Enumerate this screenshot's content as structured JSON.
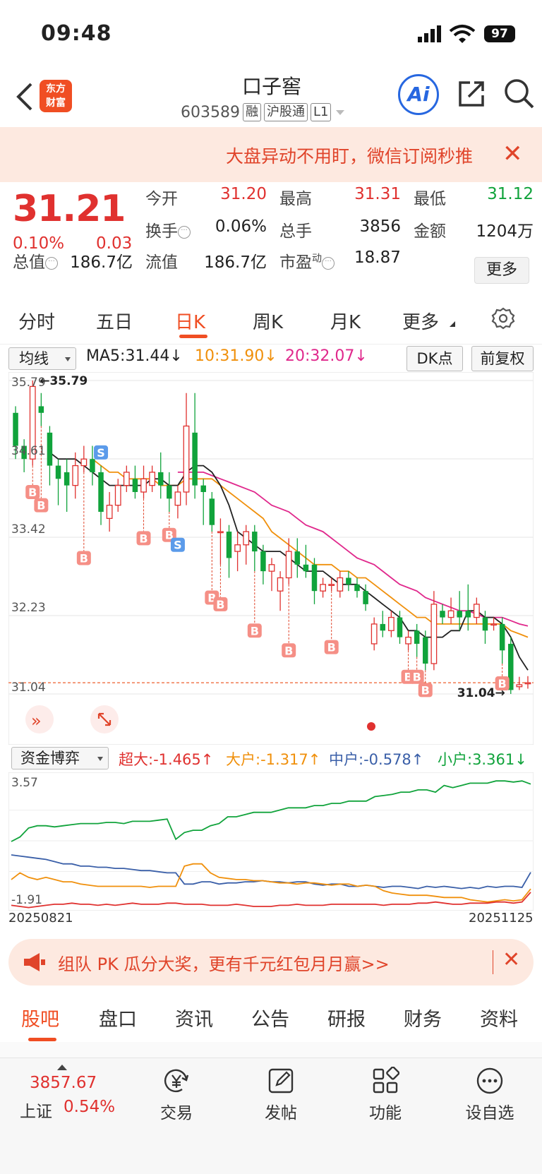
{
  "status_bar": {
    "time": "09:48",
    "battery": "97"
  },
  "header": {
    "logo_line1": "东方",
    "logo_line2": "财富",
    "stock_name": "口子窖",
    "stock_code": "603589",
    "tags": [
      "融",
      "沪股通",
      "L1"
    ],
    "ai_label": "Ai"
  },
  "notice": {
    "text": "大盘异动不用盯，微信订阅秒推",
    "close": "✕"
  },
  "quote": {
    "price": "31.21",
    "change_pct": "0.10%",
    "change": "0.03",
    "open_label": "今开",
    "open": "31.20",
    "high_label": "最高",
    "high": "31.31",
    "low_label": "最低",
    "low": "31.12",
    "turnover_label": "换手",
    "turnover": "0.06%",
    "volume_label": "总手",
    "volume": "3856",
    "amount_label": "金额",
    "amount": "1204万",
    "mktcap_label": "总值",
    "mktcap": "186.7亿",
    "float_label": "流值",
    "float_cap": "186.7亿",
    "pe_label": "市盈",
    "pe_sup": "动",
    "pe": "18.87",
    "more": "更多"
  },
  "period_tabs": [
    "分时",
    "五日",
    "日K",
    "周K",
    "月K",
    "更多"
  ],
  "ma_bar": {
    "selector": "均线",
    "ma5": "MA5:31.44↓",
    "ma10": "10:31.90↓",
    "ma20": "20:32.07↓",
    "dk": "DK点",
    "fuquan": "前复权"
  },
  "colors": {
    "up": "#e0312f",
    "down": "#10a33b",
    "ma5": "#222222",
    "ma10": "#f0900c",
    "ma20": "#e0288c",
    "accent": "#f04e23"
  },
  "chart_data": {
    "type": "candlestick",
    "y_ticks": [
      "35.79",
      "34.61",
      "33.42",
      "32.23",
      "31.04"
    ],
    "ylim": [
      31.04,
      35.79
    ],
    "max_label": "35.79",
    "min_label": "31.04",
    "last_close": 31.21,
    "candles": [
      [
        35.3,
        34.8,
        35.4,
        34.6
      ],
      [
        34.8,
        34.6,
        34.9,
        34.4
      ],
      [
        34.6,
        35.7,
        35.79,
        34.5
      ],
      [
        35.4,
        35.3,
        35.6,
        35.1
      ],
      [
        35.0,
        34.5,
        35.1,
        34.2
      ],
      [
        34.5,
        34.3,
        34.6,
        33.9
      ],
      [
        34.4,
        34.2,
        34.6,
        33.8
      ],
      [
        34.2,
        34.5,
        34.7,
        34.0
      ],
      [
        34.5,
        34.6,
        34.8,
        34.4
      ],
      [
        34.6,
        34.4,
        34.8,
        34.2
      ],
      [
        34.4,
        33.8,
        34.5,
        33.6
      ],
      [
        33.7,
        33.9,
        34.1,
        33.5
      ],
      [
        33.9,
        34.2,
        34.3,
        33.8
      ],
      [
        34.2,
        34.4,
        34.5,
        34.1
      ],
      [
        34.3,
        34.1,
        34.5,
        34.0
      ],
      [
        34.1,
        34.3,
        34.5,
        34.0
      ],
      [
        34.2,
        34.4,
        34.5,
        34.1
      ],
      [
        34.4,
        34.2,
        34.7,
        34.0
      ],
      [
        34.2,
        34.0,
        34.4,
        33.8
      ],
      [
        33.9,
        34.1,
        34.2,
        33.7
      ],
      [
        34.1,
        35.1,
        35.6,
        33.9
      ],
      [
        35.0,
        34.2,
        35.6,
        34.0
      ],
      [
        34.2,
        34.1,
        34.3,
        33.6
      ],
      [
        34.0,
        33.6,
        34.1,
        33.5
      ],
      [
        33.5,
        33.5,
        33.7,
        33.0
      ],
      [
        33.5,
        33.1,
        33.6,
        32.8
      ],
      [
        33.2,
        33.3,
        33.5,
        32.9
      ],
      [
        33.3,
        33.5,
        33.6,
        33.0
      ],
      [
        33.5,
        33.2,
        33.6,
        32.9
      ],
      [
        33.2,
        32.9,
        33.3,
        32.7
      ],
      [
        32.9,
        33.0,
        33.1,
        32.6
      ],
      [
        32.6,
        32.8,
        32.9,
        32.3
      ],
      [
        32.8,
        33.2,
        33.4,
        32.7
      ],
      [
        33.2,
        33.0,
        33.4,
        32.8
      ],
      [
        33.0,
        32.9,
        33.3,
        32.8
      ],
      [
        33.0,
        32.6,
        33.1,
        32.4
      ],
      [
        32.6,
        32.7,
        32.8,
        32.5
      ],
      [
        32.7,
        32.7,
        32.8,
        32.6
      ],
      [
        32.6,
        32.8,
        32.9,
        32.5
      ],
      [
        32.8,
        32.7,
        32.9,
        32.6
      ],
      [
        32.7,
        32.6,
        32.8,
        32.5
      ],
      [
        32.6,
        32.4,
        32.7,
        32.3
      ],
      [
        31.8,
        32.1,
        32.2,
        31.7
      ],
      [
        32.1,
        32.0,
        32.3,
        31.9
      ],
      [
        32.0,
        32.2,
        32.3,
        31.9
      ],
      [
        32.2,
        31.9,
        32.3,
        31.8
      ],
      [
        31.8,
        31.9,
        32.0,
        31.7
      ],
      [
        32.0,
        31.8,
        32.1,
        31.6
      ],
      [
        31.9,
        31.5,
        32.0,
        31.4
      ],
      [
        31.5,
        32.4,
        32.6,
        31.4
      ],
      [
        32.3,
        32.2,
        32.4,
        32.1
      ],
      [
        32.2,
        32.3,
        32.5,
        32.1
      ],
      [
        32.3,
        32.2,
        32.6,
        32.0
      ],
      [
        32.3,
        32.2,
        32.7,
        32.0
      ],
      [
        32.2,
        32.4,
        32.5,
        32.1
      ],
      [
        32.2,
        32.0,
        32.3,
        31.8
      ],
      [
        32.1,
        32.1,
        32.2,
        32.0
      ],
      [
        32.1,
        31.7,
        32.2,
        31.5
      ],
      [
        31.8,
        31.1,
        31.9,
        31.04
      ],
      [
        31.15,
        31.18,
        31.3,
        31.1
      ],
      [
        31.2,
        31.21,
        31.31,
        31.12
      ]
    ],
    "ma5": [
      null,
      null,
      null,
      null,
      34.7,
      34.6,
      34.6,
      34.6,
      34.5,
      34.4,
      34.3,
      34.2,
      34.2,
      34.2,
      34.2,
      34.2,
      34.3,
      34.3,
      34.2,
      34.2,
      34.4,
      34.5,
      34.5,
      34.4,
      34.2,
      33.9,
      33.5,
      33.4,
      33.3,
      33.2,
      33.2,
      33.2,
      33.1,
      33.0,
      32.9,
      32.9,
      32.9,
      32.8,
      32.7,
      32.7,
      32.7,
      32.6,
      32.5,
      32.4,
      32.3,
      32.2,
      32.0,
      32.0,
      31.9,
      31.9,
      31.9,
      32.0,
      32.0,
      32.3,
      32.3,
      32.2,
      32.2,
      32.1,
      31.9,
      31.6,
      31.4
    ],
    "ma10": [
      null,
      null,
      null,
      null,
      null,
      null,
      null,
      null,
      null,
      34.6,
      34.5,
      34.4,
      34.4,
      34.3,
      34.3,
      34.3,
      34.3,
      34.2,
      34.2,
      34.2,
      34.3,
      34.3,
      34.3,
      34.3,
      34.2,
      34.1,
      34.0,
      33.9,
      33.8,
      33.7,
      33.5,
      33.4,
      33.3,
      33.2,
      33.1,
      33.0,
      33.0,
      33.0,
      32.9,
      32.9,
      32.8,
      32.8,
      32.7,
      32.6,
      32.5,
      32.4,
      32.3,
      32.2,
      32.2,
      32.1,
      32.1,
      32.1,
      32.1,
      32.1,
      32.1,
      32.1,
      32.1,
      32.1,
      32.0,
      31.95,
      31.9
    ],
    "ma20": [
      null,
      null,
      null,
      null,
      null,
      null,
      null,
      null,
      null,
      null,
      null,
      null,
      null,
      null,
      null,
      null,
      null,
      null,
      null,
      34.4,
      34.4,
      34.4,
      34.4,
      34.35,
      34.3,
      34.25,
      34.2,
      34.15,
      34.1,
      34.0,
      33.9,
      33.85,
      33.8,
      33.7,
      33.6,
      33.55,
      33.5,
      33.4,
      33.3,
      33.2,
      33.1,
      33.05,
      33.0,
      32.9,
      32.8,
      32.7,
      32.65,
      32.6,
      32.5,
      32.45,
      32.4,
      32.35,
      32.3,
      32.3,
      32.25,
      32.2,
      32.2,
      32.2,
      32.15,
      32.1,
      32.07
    ],
    "b_markers": [
      {
        "i": 2,
        "price": 34.1
      },
      {
        "i": 3,
        "price": 33.9
      },
      {
        "i": 8,
        "price": 33.1
      },
      {
        "i": 15,
        "price": 33.4
      },
      {
        "i": 18,
        "price": 33.45
      },
      {
        "i": 23,
        "price": 32.5
      },
      {
        "i": 24,
        "price": 32.4
      },
      {
        "i": 28,
        "price": 32.0
      },
      {
        "i": 32,
        "price": 31.7
      },
      {
        "i": 37,
        "price": 31.75
      },
      {
        "i": 46,
        "price": 31.3
      },
      {
        "i": 47,
        "price": 31.3
      },
      {
        "i": 48,
        "price": 31.1
      },
      {
        "i": 57,
        "price": 31.2
      }
    ],
    "s_markers": [
      {
        "i": 10,
        "price": 34.7
      },
      {
        "i": 19,
        "price": 33.3
      }
    ],
    "marker_b": "B",
    "marker_s": "S"
  },
  "fund_bar": {
    "selector": "资金博弈",
    "super": "超大:-1.465↑",
    "large": "大户:-1.317↑",
    "medium": "中户:-0.578↑",
    "small": "小户:3.361↓"
  },
  "fund_chart_data": {
    "type": "line",
    "ylim": [
      -1.91,
      3.57
    ],
    "y_ticks": [
      "3.57",
      "-1.91"
    ],
    "x_labels": [
      "20250821",
      "20251125"
    ],
    "series": [
      {
        "color": "#10a33b",
        "values": [
          0.8,
          1.0,
          1.4,
          1.5,
          1.5,
          1.45,
          1.5,
          1.55,
          1.6,
          1.6,
          1.6,
          1.65,
          1.65,
          1.6,
          1.7,
          1.7,
          1.7,
          1.75,
          1.8,
          0.9,
          1.2,
          1.3,
          1.3,
          1.5,
          1.6,
          1.9,
          1.9,
          2.0,
          2.1,
          2.1,
          2.1,
          2.2,
          2.3,
          2.3,
          2.3,
          2.4,
          2.4,
          2.5,
          2.5,
          2.6,
          2.6,
          2.6,
          2.8,
          2.85,
          2.9,
          3.0,
          3.0,
          3.1,
          3.1,
          3.0,
          3.3,
          3.2,
          3.3,
          3.4,
          3.4,
          3.4,
          3.5,
          3.5,
          3.45,
          3.5,
          3.36
        ]
      },
      {
        "color": "#3a5fa8",
        "values": [
          0.2,
          0.15,
          0.1,
          0.05,
          0.0,
          -0.1,
          -0.2,
          -0.2,
          -0.3,
          -0.3,
          -0.35,
          -0.35,
          -0.4,
          -0.4,
          -0.45,
          -0.5,
          -0.5,
          -0.55,
          -0.6,
          -0.6,
          -1.1,
          -1.1,
          -1.0,
          -1.0,
          -1.1,
          -1.05,
          -1.05,
          -1.0,
          -1.0,
          -0.95,
          -1.0,
          -1.0,
          -1.05,
          -1.0,
          -1.0,
          -1.1,
          -1.15,
          -1.1,
          -1.1,
          -1.2,
          -1.2,
          -1.15,
          -1.2,
          -1.25,
          -1.2,
          -1.2,
          -1.25,
          -1.3,
          -1.2,
          -1.25,
          -1.2,
          -1.25,
          -1.3,
          -1.25,
          -1.3,
          -1.2,
          -1.25,
          -1.2,
          -1.2,
          -1.25,
          -0.578
        ]
      },
      {
        "color": "#f0900c",
        "values": [
          -0.9,
          -0.6,
          -0.8,
          -0.9,
          -0.8,
          -0.9,
          -1.0,
          -1.0,
          -1.1,
          -1.15,
          -1.2,
          -1.2,
          -1.2,
          -1.2,
          -1.2,
          -1.2,
          -1.25,
          -1.2,
          -1.2,
          -1.2,
          -0.3,
          -0.2,
          -0.2,
          -0.6,
          -0.8,
          -0.85,
          -0.9,
          -0.9,
          -0.95,
          -0.95,
          -1.0,
          -1.05,
          -1.05,
          -1.1,
          -1.05,
          -1.05,
          -1.1,
          -1.15,
          -1.1,
          -1.1,
          -1.2,
          -1.15,
          -1.2,
          -1.4,
          -1.5,
          -1.55,
          -1.6,
          -1.6,
          -1.6,
          -1.65,
          -1.7,
          -1.7,
          -1.7,
          -1.8,
          -1.85,
          -1.9,
          -1.85,
          -1.8,
          -1.85,
          -1.8,
          -1.317
        ]
      },
      {
        "color": "#e0312f",
        "values": [
          -2.05,
          -2.1,
          -2.15,
          -2.1,
          -2.05,
          -2.0,
          -2.0,
          -1.95,
          -2.0,
          -2.0,
          -2.05,
          -2.0,
          -2.05,
          -2.0,
          -1.95,
          -2.0,
          -2.0,
          -2.0,
          -1.95,
          -1.95,
          -2.0,
          -2.0,
          -2.0,
          -2.05,
          -2.05,
          -2.05,
          -2.0,
          -2.05,
          -2.1,
          -2.1,
          -2.1,
          -2.05,
          -2.05,
          -2.0,
          -2.05,
          -2.05,
          -2.05,
          -2.0,
          -2.0,
          -2.0,
          -2.0,
          -2.0,
          -2.0,
          -2.05,
          -2.0,
          -2.0,
          -2.0,
          -1.95,
          -1.95,
          -1.9,
          -1.95,
          -2.0,
          -2.0,
          -1.95,
          -1.95,
          -1.95,
          -1.9,
          -1.9,
          -1.95,
          -1.9,
          -1.465
        ]
      }
    ]
  },
  "promo": {
    "text": "组队 PK 瓜分大奖，更有千元红包月月赢>>",
    "close": "✕"
  },
  "content_tabs": [
    "股吧",
    "盘口",
    "资讯",
    "公告",
    "研报",
    "财务",
    "资料"
  ],
  "bottom_bar": {
    "index_value": "3857.67",
    "index_name": "上证",
    "index_pct": "0.54%",
    "items": [
      "交易",
      "发帖",
      "功能",
      "设自选"
    ]
  }
}
